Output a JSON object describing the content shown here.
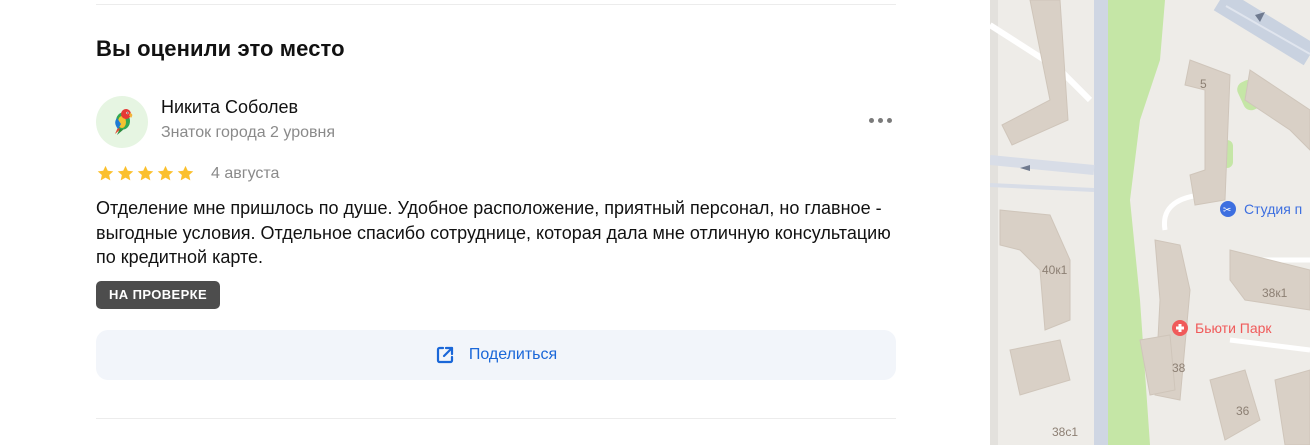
{
  "review_section": {
    "title": "Вы оценили это место"
  },
  "author": {
    "name": "Никита Соболев",
    "level": "Знаток города 2 уровня",
    "avatar_icon": "parrot-icon"
  },
  "review": {
    "rating": 5,
    "rating_max": 5,
    "date": "4 августа",
    "text": "Отделение мне пришлось по душе. Удобное расположение, приятный персонал, но главное - выгодные условия. Отдельное спасибо сотруднице, которая дала мне отличную консультацию по кредитной карте.",
    "status_badge": "НА ПРОВЕРКЕ"
  },
  "share": {
    "label": "Поделиться",
    "icon": "external-share-icon"
  },
  "more_menu_icon": "more-dots-icon",
  "colors": {
    "star": "#fbc02d",
    "badge_bg": "#4d4d4d",
    "link": "#1a67d8",
    "share_bg": "#f2f5fa",
    "map_poi_blue": "#3d6fe0",
    "map_poi_red": "#f05a5a"
  },
  "map": {
    "house_numbers": [
      "5",
      "40к1",
      "38к1",
      "38",
      "36",
      "38с1"
    ],
    "pois": [
      {
        "name": "Студия п",
        "icon": "barber-icon"
      },
      {
        "name": "Бьюти Парк",
        "icon": "medical-cross-icon"
      }
    ]
  }
}
